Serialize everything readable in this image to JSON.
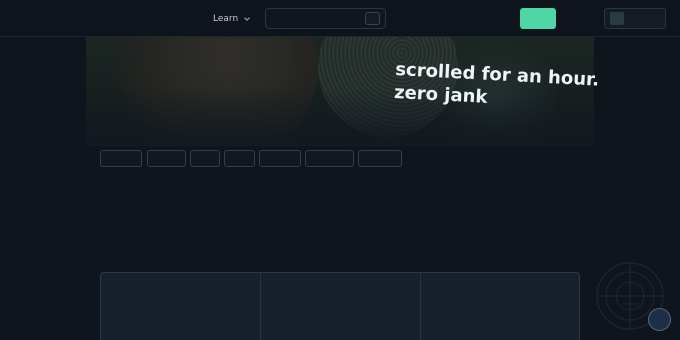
{
  "nav": {
    "learn_label": "Learn"
  },
  "hero": {
    "quote": "scrolled for an hour. zero jank"
  },
  "colors": {
    "accent": "#4fd6a6",
    "background": "#0f151d",
    "panel": "#17212b"
  },
  "icons": {
    "learn_menu": "chevron-down-icon",
    "watermark": "crosshair-compass-icon"
  },
  "chips_count": 7
}
